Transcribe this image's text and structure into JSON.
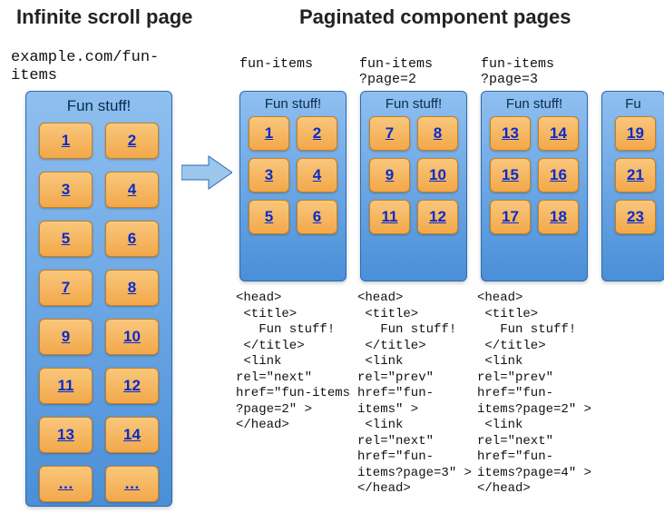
{
  "headings": {
    "left": "Infinite scroll page",
    "right": "Paginated component pages"
  },
  "urls": {
    "left": "example.com/fun-\nitems",
    "p1": "fun-items",
    "p2": "fun-items\n?page=2",
    "p3": "fun-items\n?page=3"
  },
  "panel_title": "Fun stuff!",
  "panel_title_cut": "Fu",
  "left_items": [
    "1",
    "2",
    "3",
    "4",
    "5",
    "6",
    "7",
    "8",
    "9",
    "10",
    "11",
    "12",
    "13",
    "14",
    "…",
    "…"
  ],
  "pages": {
    "p1": [
      "1",
      "2",
      "3",
      "4",
      "5",
      "6"
    ],
    "p2": [
      "7",
      "8",
      "9",
      "10",
      "11",
      "12"
    ],
    "p3": [
      "13",
      "14",
      "15",
      "16",
      "17",
      "18"
    ],
    "p4": [
      "19",
      "21",
      "23"
    ]
  },
  "code": {
    "p1": "<head>\n <title>\n   Fun stuff!\n </title>\n <link\nrel=\"next\"\nhref=\"fun-items\n?page=2\" >\n</head>",
    "p2": "<head>\n <title>\n   Fun stuff!\n </title>\n <link\nrel=\"prev\"\nhref=\"fun-\nitems\" >\n <link\nrel=\"next\"\nhref=\"fun-\nitems?page=3\" >\n</head>",
    "p3": "<head>\n <title>\n   Fun stuff!\n </title>\n <link\nrel=\"prev\"\nhref=\"fun-\nitems?page=2\" >\n <link\nrel=\"next\"\nhref=\"fun-\nitems?page=4\" >\n</head>"
  }
}
